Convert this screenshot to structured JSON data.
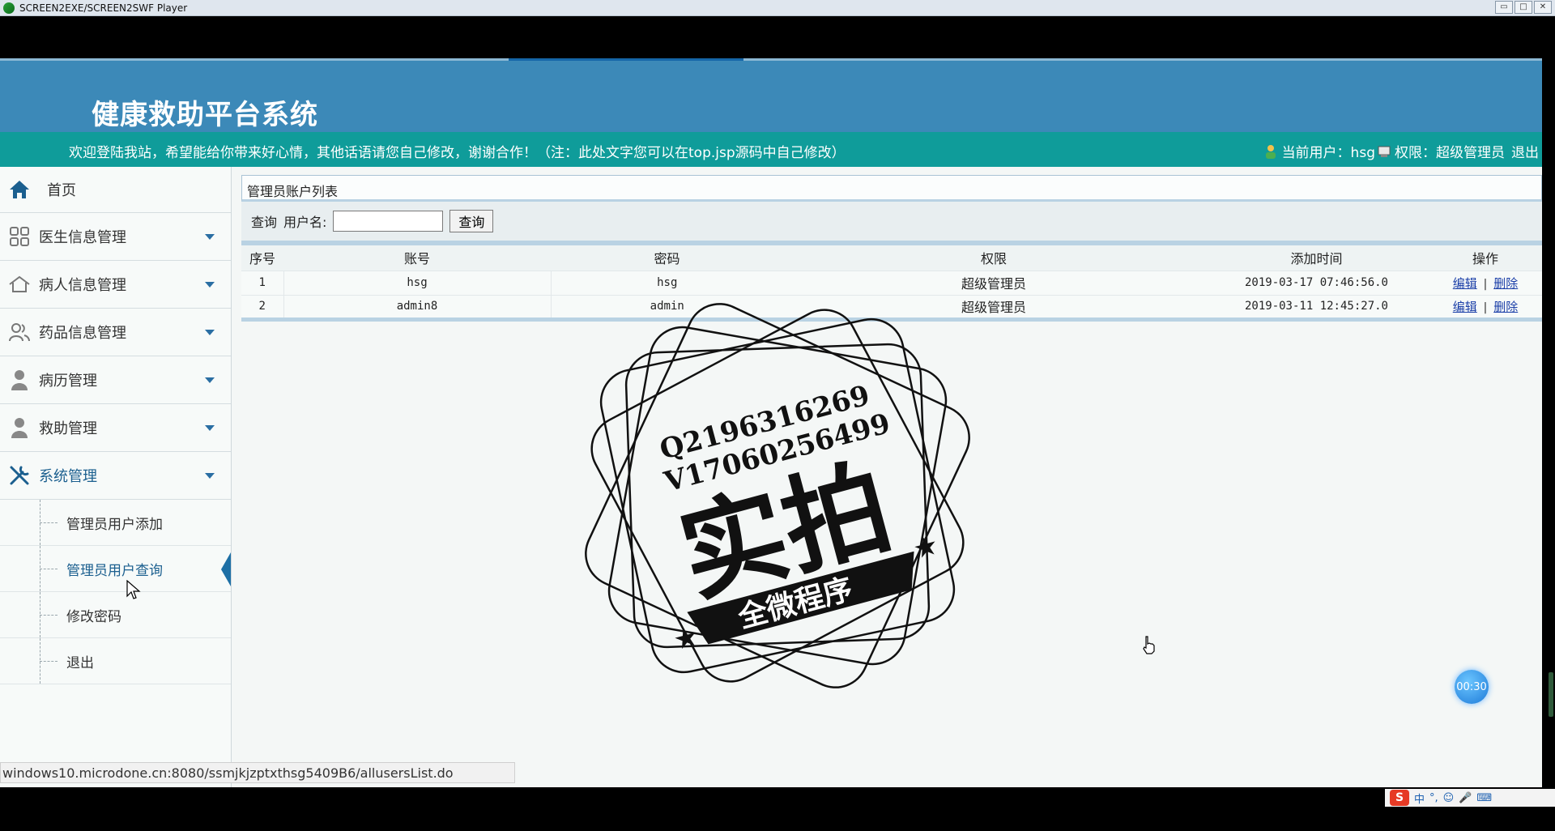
{
  "player": {
    "title": "SCREEN2EXE/SCREEN2SWF Player",
    "controls": [
      "▭",
      "□",
      "✕"
    ]
  },
  "header": {
    "site_title": "健康救助平台系统"
  },
  "notice": {
    "text": "欢迎登陆我站，希望能给你带来好心情，其他话语请您自己修改，谢谢合作！（注：此处文字您可以在top.jsp源码中自己修改）",
    "current_user": "当前用户：hsg",
    "permission": "权限：超级管理员",
    "logout": "退出"
  },
  "sidebar": {
    "home": "首页",
    "items": [
      {
        "label": "医生信息管理"
      },
      {
        "label": "病人信息管理"
      },
      {
        "label": "药品信息管理"
      },
      {
        "label": "病历管理"
      },
      {
        "label": "救助管理"
      },
      {
        "label": "系统管理"
      }
    ],
    "sub_items": [
      {
        "label": "管理员用户添加"
      },
      {
        "label": "管理员用户查询"
      },
      {
        "label": "修改密码"
      },
      {
        "label": "退出"
      }
    ]
  },
  "content": {
    "panel_title": "管理员账户列表",
    "search_prefix": "查询",
    "search_label": "用户名:",
    "search_value": "",
    "search_button": "查询",
    "columns": [
      "序号",
      "账号",
      "密码",
      "权限",
      "添加时间",
      "操作"
    ],
    "rows": [
      {
        "index": "1",
        "account": "hsg",
        "password": "hsg",
        "role": "超级管理员",
        "time": "2019-03-17 07:46:56.0",
        "edit": "编辑",
        "delete": "删除"
      },
      {
        "index": "2",
        "account": "admin8",
        "password": "admin",
        "role": "超级管理员",
        "time": "2019-03-11 12:45:27.0",
        "edit": "编辑",
        "delete": "删除"
      }
    ],
    "op_separator": "|"
  },
  "watermark": {
    "line1": "Q2196316269",
    "line2": "V17060256499",
    "big": "实拍",
    "ribbon": "全微程序"
  },
  "status_bar": {
    "url": "windows10.microdone.cn:8080/ssmjkjzptxthsg5409B6/allusersList.do"
  },
  "timer": {
    "value": "00:30"
  },
  "tray": {
    "logo": "S",
    "items": [
      "中",
      "°,",
      "☺",
      "🎤",
      "⌨"
    ]
  },
  "colors": {
    "header": "#3c89b8",
    "notice": "#0f9c9a",
    "accent": "#1d6fa5"
  }
}
